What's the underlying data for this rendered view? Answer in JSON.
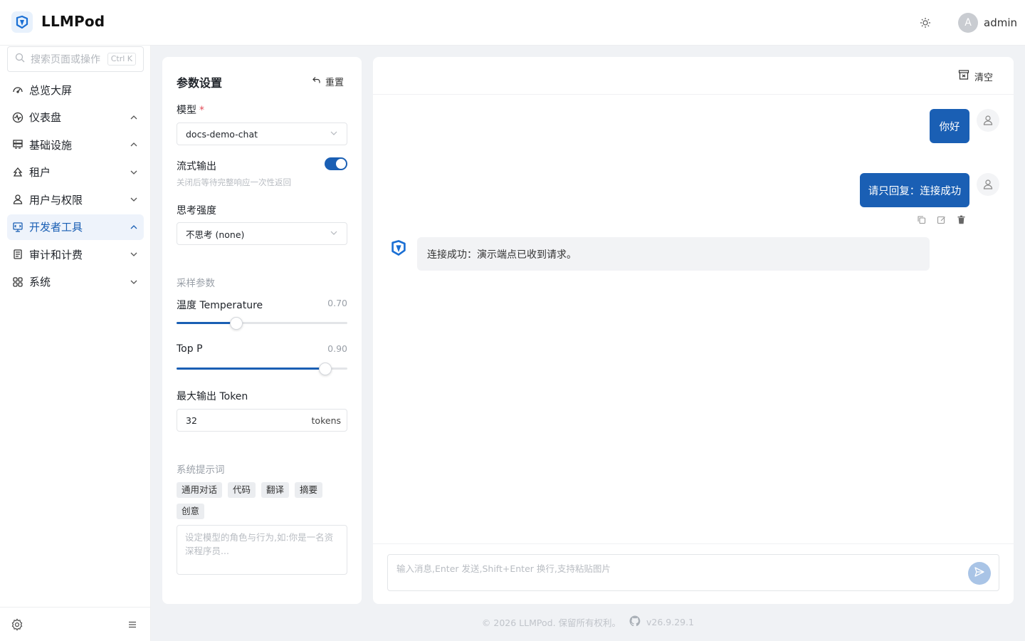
{
  "app": {
    "brand": "LLMPod"
  },
  "header": {
    "user_avatar_letter": "A",
    "username": "admin"
  },
  "sidebar": {
    "search_placeholder": "搜索页面或操作",
    "search_shortcut": "Ctrl K",
    "items": [
      {
        "label": "总览大屏",
        "icon": "dashboard-icon",
        "chevron": ""
      },
      {
        "label": "仪表盘",
        "icon": "pulse-icon",
        "chevron": "up"
      },
      {
        "label": "基础设施",
        "icon": "server-icon",
        "chevron": "up"
      },
      {
        "label": "租户",
        "icon": "tenant-icon",
        "chevron": "down"
      },
      {
        "label": "用户与权限",
        "icon": "user-icon",
        "chevron": "down"
      },
      {
        "label": "开发者工具",
        "icon": "devtools-icon",
        "chevron": "up",
        "active": true
      },
      {
        "label": "审计和计费",
        "icon": "ledger-icon",
        "chevron": "down"
      },
      {
        "label": "系统",
        "icon": "grid-icon",
        "chevron": "down"
      }
    ]
  },
  "params": {
    "title": "参数设置",
    "reset_label": "重置",
    "model_label": "模型",
    "model_required_mark": "*",
    "model_value": "docs-demo-chat",
    "stream_label": "流式输出",
    "stream_hint": "关闭后等待完整响应一次性返回",
    "stream_enabled": true,
    "thinking_label": "思考强度",
    "thinking_value": "不思考 (none)",
    "sampling_section": "采样参数",
    "temperature_label": "温度 Temperature",
    "temperature_value": "0.70",
    "temperature_fraction": 0.35,
    "top_p_label": "Top P",
    "top_p_value": "0.90",
    "top_p_fraction": 0.87,
    "max_tokens_label": "最大输出 Token",
    "max_tokens_value": "32",
    "max_tokens_suffix": "tokens",
    "system_prompt_section": "系统提示词",
    "presets": [
      "通用对话",
      "代码",
      "翻译",
      "摘要",
      "创意"
    ],
    "system_prompt_placeholder": "设定模型的角色与行为,如:你是一名资深程序员..."
  },
  "chat": {
    "clear_label": "清空",
    "messages": [
      {
        "role": "user",
        "text": "你好"
      },
      {
        "role": "user",
        "text": "请只回复：连接成功"
      },
      {
        "role": "assistant",
        "text": "连接成功：演示端点已收到请求。"
      }
    ],
    "input_placeholder": "输入消息,Enter 发送,Shift+Enter 换行,支持粘贴图片"
  },
  "footer": {
    "copyright": "© 2026 LLMPod. 保留所有权利。",
    "version": "v26.9.29.1"
  },
  "colors": {
    "accent": "#1a5fb4",
    "send_disabled": "#a9c4e6"
  }
}
